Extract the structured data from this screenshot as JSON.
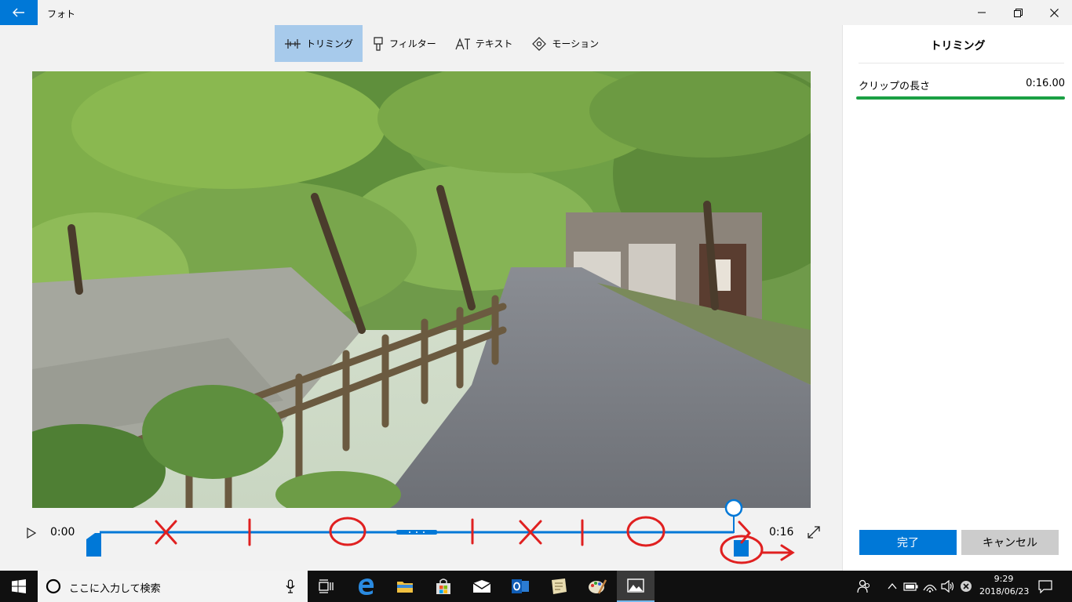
{
  "window": {
    "title": "フォト"
  },
  "toolbar": {
    "items": [
      {
        "label": "トリミング",
        "icon": "trim-icon",
        "active": true
      },
      {
        "label": "フィルター",
        "icon": "filter-icon",
        "active": false
      },
      {
        "label": "テキスト",
        "icon": "text-icon",
        "active": false
      },
      {
        "label": "モーション",
        "icon": "motion-icon",
        "active": false
      }
    ]
  },
  "timeline": {
    "start_time": "0:00",
    "end_time": "0:16",
    "progress": 1.0
  },
  "pane": {
    "title": "トリミング",
    "clip_label": "クリップの長さ",
    "clip_value": "0:16.00",
    "done_label": "完了",
    "cancel_label": "キャンセル"
  },
  "taskbar": {
    "search_placeholder": "ここに入力して検索",
    "clock_time": "9:29",
    "clock_date": "2018/06/23"
  },
  "colors": {
    "accent": "#0078d7",
    "annotation": "#e02020",
    "clip_bar": "#1ba044"
  }
}
